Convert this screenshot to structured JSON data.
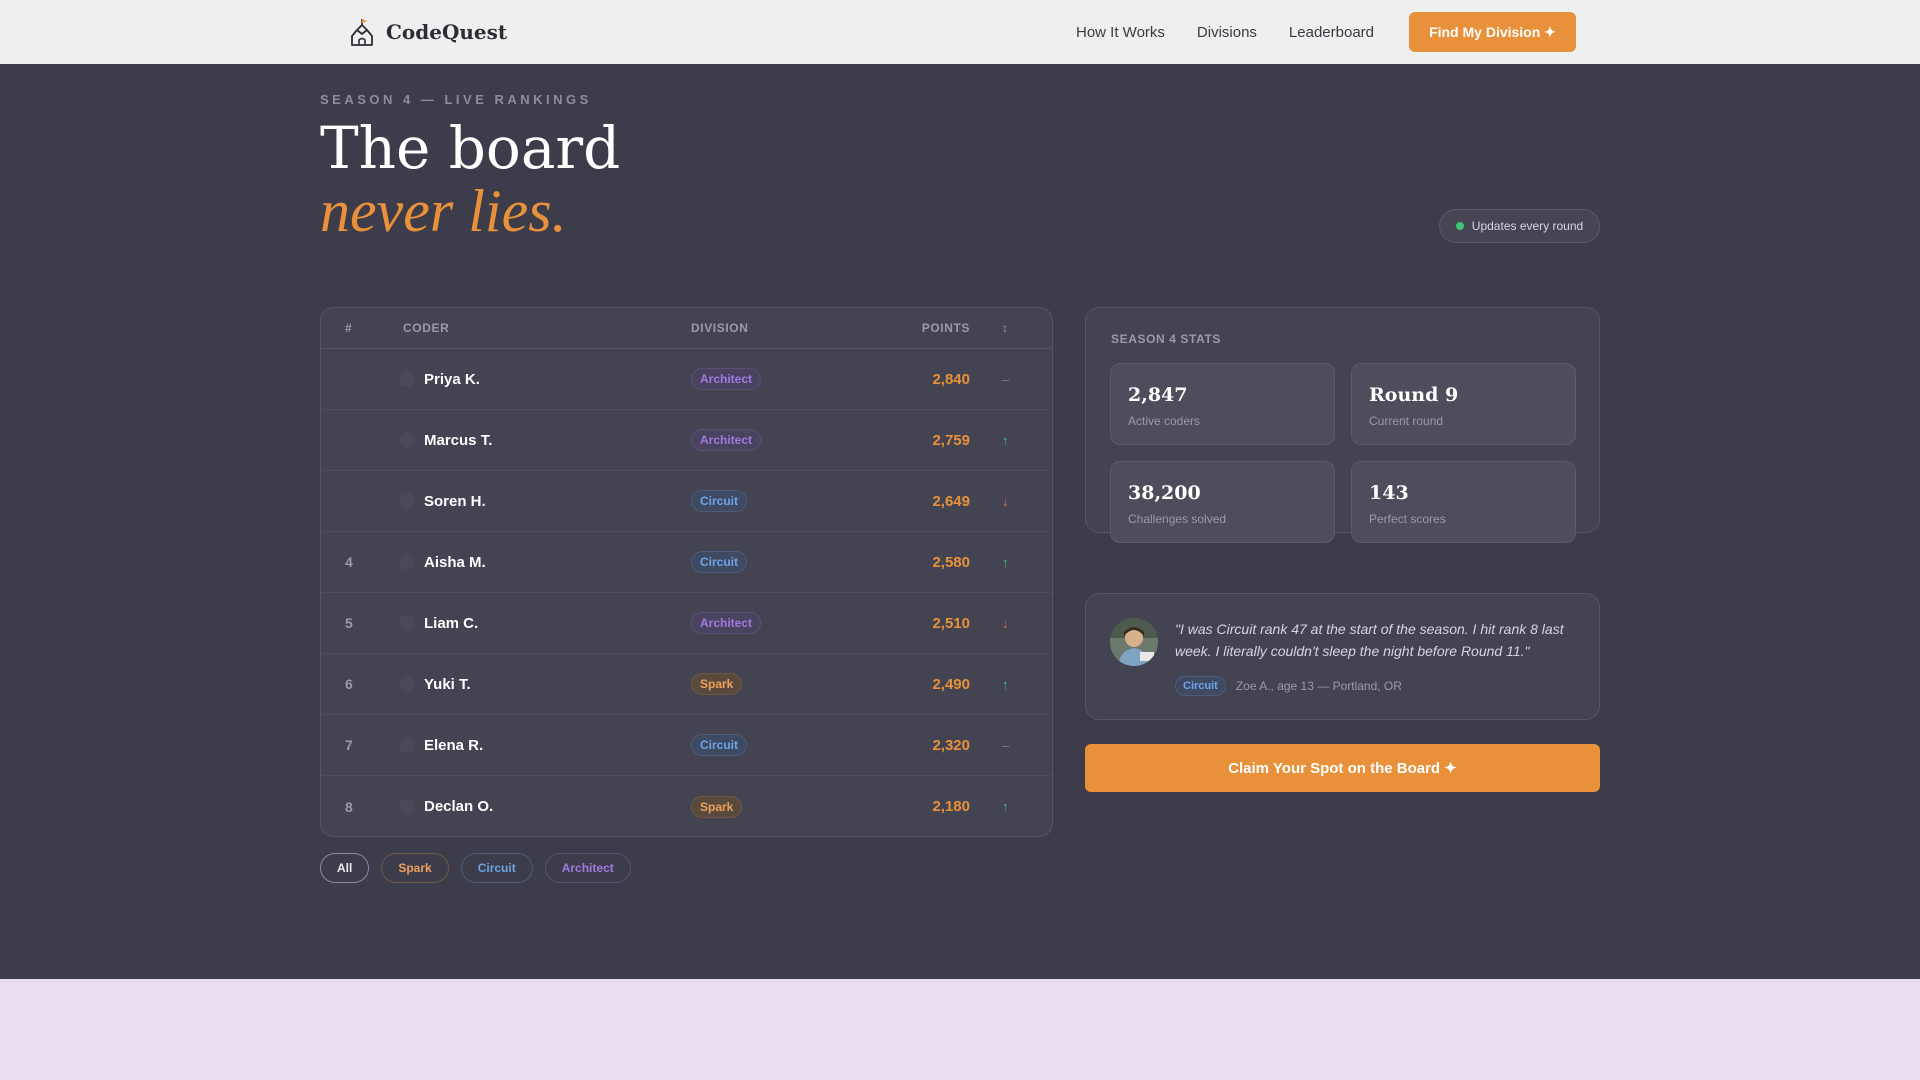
{
  "nav": {
    "brand": "CodeQuest",
    "links": [
      "How It Works",
      "Divisions",
      "Leaderboard"
    ],
    "cta": "Find My Division ✦"
  },
  "hero": {
    "eyebrow": "SEASON 4 — LIVE RANKINGS",
    "title_line1": "The board",
    "title_line2": "never lies.",
    "live_pill": "Updates every round"
  },
  "board": {
    "headers": {
      "rank": "#",
      "coder": "CODER",
      "division": "DIVISION",
      "points": "POINTS",
      "trend": "↕"
    },
    "rows": [
      {
        "rank": "",
        "name": "Priya K.",
        "division": "Architect",
        "points": "2,840",
        "trend": "–"
      },
      {
        "rank": "",
        "name": "Marcus T.",
        "division": "Architect",
        "points": "2,759",
        "trend": "↑"
      },
      {
        "rank": "",
        "name": "Soren H.",
        "division": "Circuit",
        "points": "2,649",
        "trend": "↓"
      },
      {
        "rank": "4",
        "name": "Aisha M.",
        "division": "Circuit",
        "points": "2,580",
        "trend": "↑"
      },
      {
        "rank": "5",
        "name": "Liam C.",
        "division": "Architect",
        "points": "2,510",
        "trend": "↓"
      },
      {
        "rank": "6",
        "name": "Yuki T.",
        "division": "Spark",
        "points": "2,490",
        "trend": "↑"
      },
      {
        "rank": "7",
        "name": "Elena R.",
        "division": "Circuit",
        "points": "2,320",
        "trend": "–"
      },
      {
        "rank": "8",
        "name": "Declan O.",
        "division": "Spark",
        "points": "2,180",
        "trend": "↑"
      }
    ]
  },
  "filters": [
    "All",
    "Spark",
    "Circuit",
    "Architect"
  ],
  "stats": {
    "title": "SEASON 4 STATS",
    "items": [
      {
        "value": "2,847",
        "label": "Active coders"
      },
      {
        "value": "Round 9",
        "label": "Current round"
      },
      {
        "value": "38,200",
        "label": "Challenges solved"
      },
      {
        "value": "143",
        "label": "Perfect scores"
      }
    ]
  },
  "testimonial": {
    "quote": "\"I was Circuit rank 47 at the start of the season. I hit rank 8 last week. I literally couldn't sleep the night before Round 11.\"",
    "division": "Circuit",
    "author": "Zoe A., age 13 — Portland, OR"
  },
  "claim_cta": "Claim Your Spot on the Board ✦",
  "colors": {
    "accent": "#e8913a",
    "hero_bg": "#3c3c4a",
    "architect": "#9f7be0",
    "circuit": "#6ea3e8",
    "spark": "#eda05a",
    "up": "#3fc47a",
    "down": "#e06b4b"
  }
}
